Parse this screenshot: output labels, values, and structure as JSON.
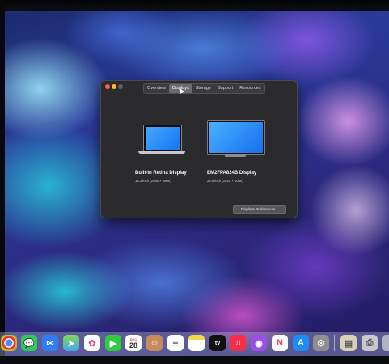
{
  "window": {
    "tabs": [
      {
        "label": "Overview"
      },
      {
        "label": "Displays"
      },
      {
        "label": "Storage"
      },
      {
        "label": "Support"
      },
      {
        "label": "Resources"
      }
    ],
    "active_tab": "Displays",
    "displays": [
      {
        "name": "Built-in Retina Display",
        "size": "15.3-inch (2560 × 1600)"
      },
      {
        "name": "EM2FPA824B Display",
        "size": "23.5-inch (1920 × 1080)"
      }
    ],
    "preferences_button": "Displays Preferences..."
  },
  "dock": {
    "calendar_month": "DEC",
    "calendar_day": "28",
    "tv_label": "tv",
    "items": [
      "chrome-icon",
      "messages-icon",
      "mail-icon",
      "maps-icon",
      "photos-icon",
      "facetime-icon",
      "calendar-icon",
      "contacts-icon",
      "reminders-icon",
      "notes-icon",
      "appletv-icon",
      "music-icon",
      "podcasts-icon",
      "news-icon",
      "appstore-icon",
      "system-preferences-icon",
      "preview-icon",
      "printer-icon"
    ]
  },
  "colors": {
    "window_bg": "#2b2b2d",
    "close": "#fe5f57",
    "minimize": "#febc2e",
    "display_blue": "#1576f0"
  }
}
